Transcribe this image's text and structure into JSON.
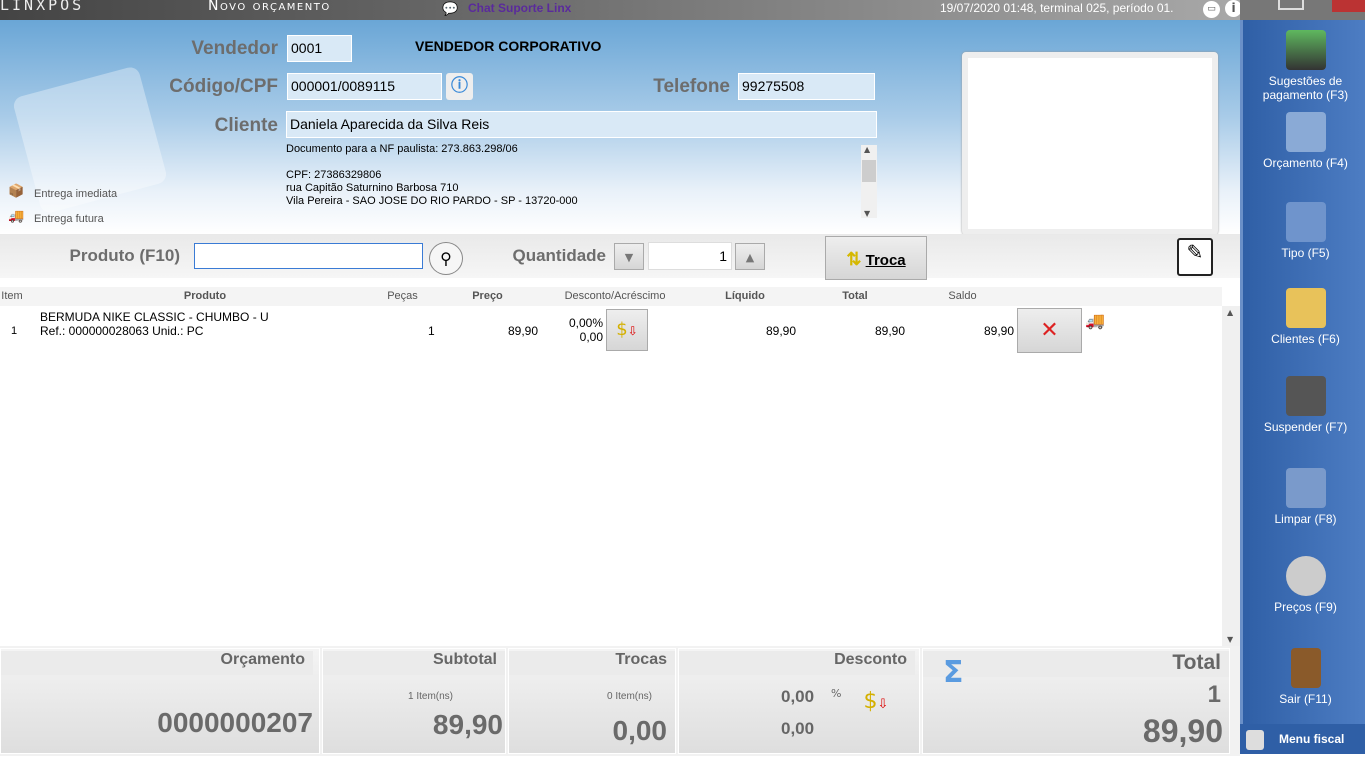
{
  "topbar": {
    "logo": "LINXPOS",
    "title": "Novo orçamento",
    "chat": "Chat Suporte Linx",
    "status": "19/07/2020 01:48, terminal 025, período 01."
  },
  "header": {
    "vendedor_label": "Vendedor",
    "vendedor_code": "0001",
    "vendedor_name": "VENDEDOR CORPORATIVO",
    "codigo_label": "Código/CPF",
    "codigo_value": "000001/0089115",
    "telefone_label": "Telefone",
    "telefone_value": "99275508",
    "cliente_label": "Cliente",
    "cliente_value": "Daniela  Aparecida da Silva Reis",
    "notes": [
      "Documento para a NF paulista: 273.863.298/06",
      "",
      "CPF: 27386329806",
      "rua Capitão Saturnino Barbosa 710",
      "Vila Pereira - SAO JOSE DO RIO PARDO - SP - 13720-000"
    ],
    "entrega_imediata": "Entrega imediata",
    "entrega_futura": "Entrega futura"
  },
  "product_bar": {
    "produto_label": "Produto (F10)",
    "produto_value": "",
    "quantidade_label": "Quantidade",
    "quantidade_value": "1",
    "troca_label": "Troca"
  },
  "table": {
    "columns": [
      "Item",
      "Produto",
      "Peças",
      "Preço",
      "Desconto/Acréscimo",
      "Líquido",
      "Total",
      "Saldo"
    ],
    "rows": [
      {
        "item": "1",
        "produto": "BERMUDA NIKE CLASSIC - CHUMBO - U",
        "ref": "Ref.: 000000028063 Unid.: PC",
        "pecas": "1",
        "preco": "89,90",
        "desc_pct": "0,00%",
        "desc_val": "0,00",
        "liquido": "89,90",
        "total": "89,90",
        "saldo": "89,90"
      }
    ]
  },
  "footer": {
    "orcamento_label": "Orçamento",
    "orcamento_value": "0000000207",
    "subtotal_label": "Subtotal",
    "subtotal_items": "1 Item(ns)",
    "subtotal_value": "89,90",
    "trocas_label": "Trocas",
    "trocas_items": "0 Item(ns)",
    "trocas_value": "0,00",
    "desconto_label": "Desconto",
    "desconto_pct": "0,00",
    "pct_sign": "%",
    "desconto_value": "0,00",
    "total_label": "Total",
    "total_qty": "1",
    "total_value": "89,90"
  },
  "sidebar": {
    "items": [
      "Sugestões de pagamento (F3)",
      "Orçamento (F4)",
      "Tipo (F5)",
      "Clientes (F6)",
      "Suspender (F7)",
      "Limpar (F8)",
      "Preços (F9)",
      "Sair (F11)"
    ],
    "menu_fiscal": "Menu fiscal"
  }
}
